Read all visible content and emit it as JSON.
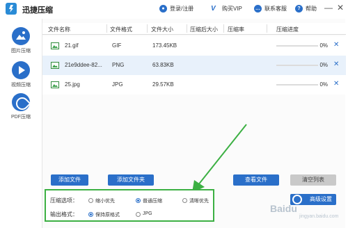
{
  "app": {
    "title": "迅捷压缩",
    "login_label": "登录/注册",
    "vip_label": "购买VIP",
    "service_label": "联系客服",
    "help_label": "帮助",
    "minimize_label": "—",
    "close_label": "✕"
  },
  "sidebar": {
    "items": [
      {
        "label": "图片压缩",
        "icon": "image-icon"
      },
      {
        "label": "视频压缩",
        "icon": "play-icon"
      },
      {
        "label": "PDF压缩",
        "icon": "pdf-icon"
      }
    ]
  },
  "table": {
    "headers": [
      "文件名称",
      "文件格式",
      "文件大小",
      "压缩后大小",
      "压缩率",
      "压缩进度"
    ],
    "rows": [
      {
        "name": "21.gif",
        "format": "GIF",
        "size": "173.45KB",
        "compressed_size": "",
        "ratio": "",
        "progress_label": "0%",
        "progress": 0,
        "selected": false
      },
      {
        "name": "21e9ddee-82...",
        "format": "PNG",
        "size": "63.83KB",
        "compressed_size": "",
        "ratio": "",
        "progress_label": "0%",
        "progress": 0,
        "selected": true
      },
      {
        "name": "25.jpg",
        "format": "JPG",
        "size": "29.57KB",
        "compressed_size": "",
        "ratio": "",
        "progress_label": "0%",
        "progress": 0,
        "selected": false
      }
    ],
    "delete_label": "✕"
  },
  "actions": {
    "add_file": "添加文件",
    "add_folder": "添加文件夹",
    "view_file": "查看文件",
    "clear_list": "清空列表"
  },
  "options": {
    "compress_label": "压缩选项：",
    "compress_choices": [
      "缩小优先",
      "普通压缩",
      "清晰优先"
    ],
    "compress_selected": 1,
    "output_label": "输出格式：",
    "output_choices": [
      "保持原格式",
      "JPG"
    ],
    "output_selected": 0
  },
  "advanced": {
    "label": "高级设置"
  },
  "watermark": {
    "text": "Baidu",
    "sub": "jingyan.baidu.com"
  },
  "colors": {
    "accent": "#2a6fc9",
    "highlight": "#3cb043",
    "selected_row": "#e8f1fb"
  }
}
